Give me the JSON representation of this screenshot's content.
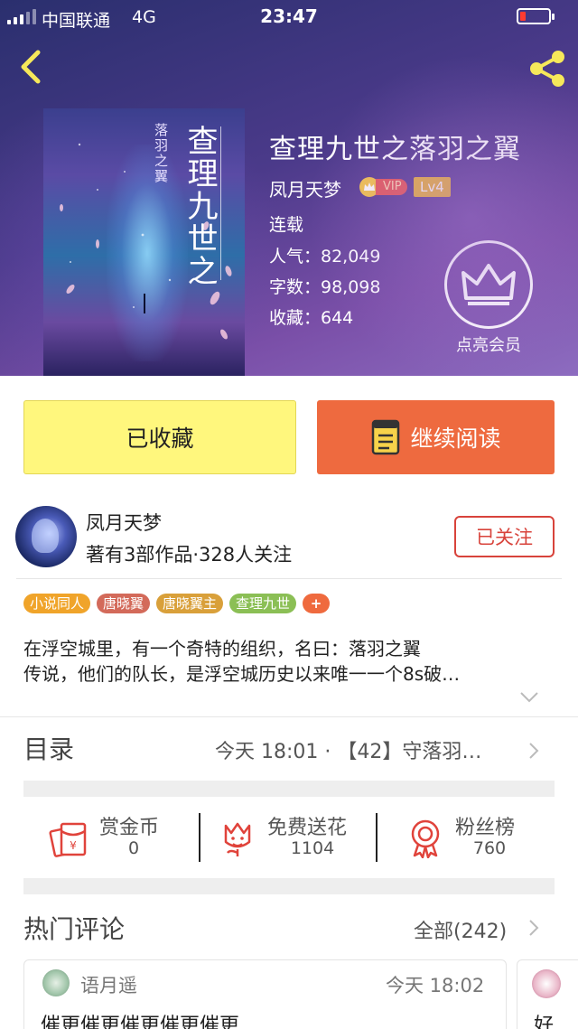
{
  "status_bar": {
    "carrier": "中国联通",
    "network": "4G",
    "time": "23:47"
  },
  "book": {
    "title": "查理九世之落羽之翼",
    "author": "凤月天梦",
    "vip_label": "VIP",
    "level": "Lv4",
    "status": "连载",
    "popularity": "人气：82,049",
    "word_count": "字数：98,098",
    "favorites": "收藏：644",
    "member_label": "点亮会员",
    "cover_title": "查理九世之",
    "cover_subtitle": "落羽之翼"
  },
  "actions": {
    "favorited_label": "已收藏",
    "continue_label": "继续阅读"
  },
  "author_card": {
    "name": "凤月天梦",
    "stats": "著有3部作品·328人关注",
    "follow_label": "已关注"
  },
  "tags": [
    {
      "label": "小说同人",
      "color": "#f0a42a"
    },
    {
      "label": "唐晓翼",
      "color": "#d36a5a"
    },
    {
      "label": "唐晓翼主",
      "color": "#d9a03a"
    },
    {
      "label": "查理九世",
      "color": "#8bbf55"
    },
    {
      "label": "+",
      "color": "#ef6a3e"
    }
  ],
  "description": {
    "line1": "在浮空城里，有一个奇特的组织，名曰：落羽之翼",
    "line2": "传说，他们的队长，是浮空城历史以来唯一一个8s破…"
  },
  "toc": {
    "title": "目录",
    "latest": "今天 18:01 · 【42】守落羽…"
  },
  "stats": [
    {
      "label": "赏金币",
      "value": "0"
    },
    {
      "label": "免费送花",
      "value": "1104"
    },
    {
      "label": "粉丝榜",
      "value": "760"
    }
  ],
  "comments": {
    "title": "热门评论",
    "all_label": "全部(242)",
    "items": [
      {
        "user": "语月遥",
        "time": "今天 18:02",
        "text": "催更催更催更催更催更"
      },
      {
        "text": "好"
      }
    ]
  }
}
